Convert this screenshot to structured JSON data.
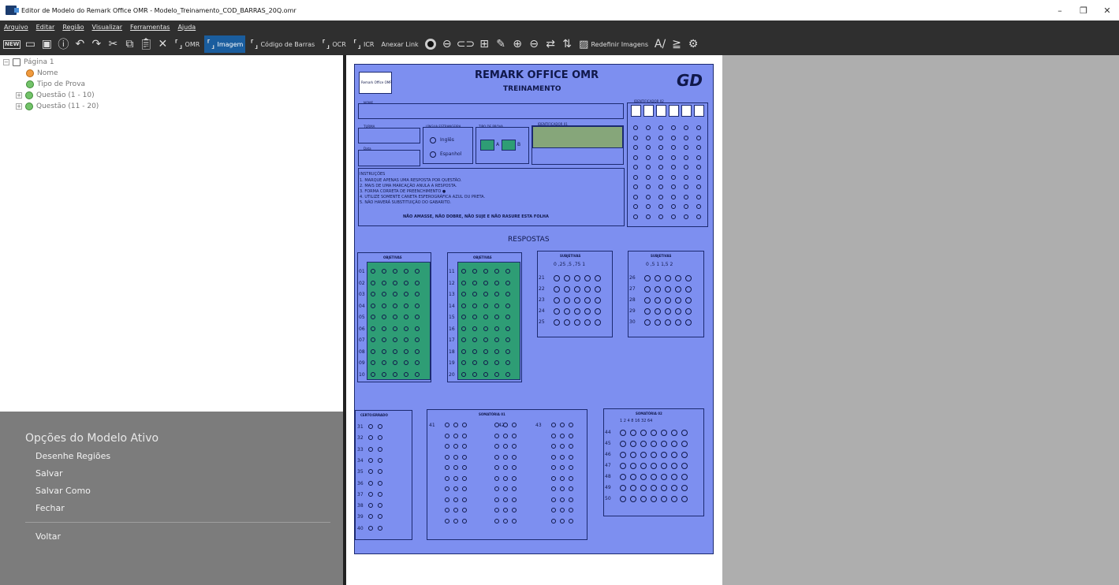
{
  "window": {
    "title": "Editor de Modelo do Remark Office OMR - Modelo_Treinamento_COD_BARRAS_20Q.omr",
    "minimize": "–",
    "restore": "❐",
    "close": "✕"
  },
  "menu": [
    "Arquivo",
    "Editar",
    "Região",
    "Visualizar",
    "Ferramentas",
    "Ajuda"
  ],
  "toolbar": {
    "new": "NEW",
    "omr": "OMR",
    "imagem": "Imagem",
    "codigo": "Código de Barras",
    "ocr": "OCR",
    "icr": "ICR",
    "anexar": "Anexar Link",
    "redefinir": "Redefinir Imagens"
  },
  "tree": {
    "page": "Página 1",
    "nome": "Nome",
    "tipo": "Tipo de Prova",
    "q1": "Questão (1 - 10)",
    "q2": "Questão (11 - 20)"
  },
  "panel": {
    "title": "Opções do Modelo Ativo",
    "items": [
      "Desenhe Regiões",
      "Salvar",
      "Salvar Como",
      "Fechar"
    ],
    "back": "Voltar"
  },
  "form": {
    "title": "REMARK OFFICE OMR",
    "subtitle": "TREINAMENTO",
    "logo_left": "Remark Office OMR",
    "logo_right": "GD",
    "nome": "NOME",
    "turma": "TURMA",
    "data": "Data",
    "lingua": "LÍNGUA ESTRANGEIRA",
    "ingles": "Inglês",
    "espanhol": "Espanhol",
    "tipo": "TIPO DE PROVA",
    "tipoA": "A",
    "tipoB": "B",
    "ident01": "IDENTIFICADOR 01",
    "ident02": "IDENTIFICADOR 02",
    "instr_title": "INSTRUÇÕES",
    "instr": [
      "1. MARQUE APENAS UMA RESPOSTA POR QUESTÃO.",
      "2. MAIS DE UMA MARCAÇÃO ANULA A RESPOSTA.",
      "3. FORMA CORRETA DE PREENCHIMENTO ●",
      "4. UTILIZE SOMENTE CANETA ESFEROGRÁFICA AZUL OU PRETA.",
      "5. NÃO HAVERÁ SUBSTITUIÇÃO DO GABARITO."
    ],
    "warning": "NÃO AMASSE, NÃO DOBRE, NÃO SUJE E NÃO RASURE ESTA FOLHA",
    "respostas": "RESPOSTAS",
    "objetivas": "OBJETIVAS",
    "subjetivas": "SUBJETIVAS",
    "subj1_scale": "0  ,25  ,5  ,75  1",
    "subj2_scale": "0  ,5  1  1,5  2",
    "certo": "CERTO/ERRADO",
    "som1": "SOMATÓRIA 01",
    "som2": "SOMATÓRIA 02",
    "som2_scale": "1   2   4   8   16  32  64",
    "obj1_rows": [
      "01",
      "02",
      "03",
      "04",
      "05",
      "06",
      "07",
      "08",
      "09",
      "10"
    ],
    "obj2_rows": [
      "11",
      "12",
      "13",
      "14",
      "15",
      "16",
      "17",
      "18",
      "19",
      "20"
    ],
    "subj1_rows": [
      "21",
      "22",
      "23",
      "24",
      "25"
    ],
    "subj2_rows": [
      "26",
      "27",
      "28",
      "29",
      "30"
    ],
    "ce_rows": [
      "31",
      "32",
      "33",
      "34",
      "35",
      "36",
      "37",
      "38",
      "39",
      "40"
    ],
    "som1_heads": [
      "41",
      "42",
      "43"
    ],
    "som2_rows": [
      "44",
      "45",
      "46",
      "47",
      "48",
      "49",
      "50"
    ]
  },
  "colors": {
    "sheet": "#7d8ff0",
    "green": "#2e9d75",
    "dark": "#2f2f2f",
    "panel": "#7c7c7c"
  }
}
